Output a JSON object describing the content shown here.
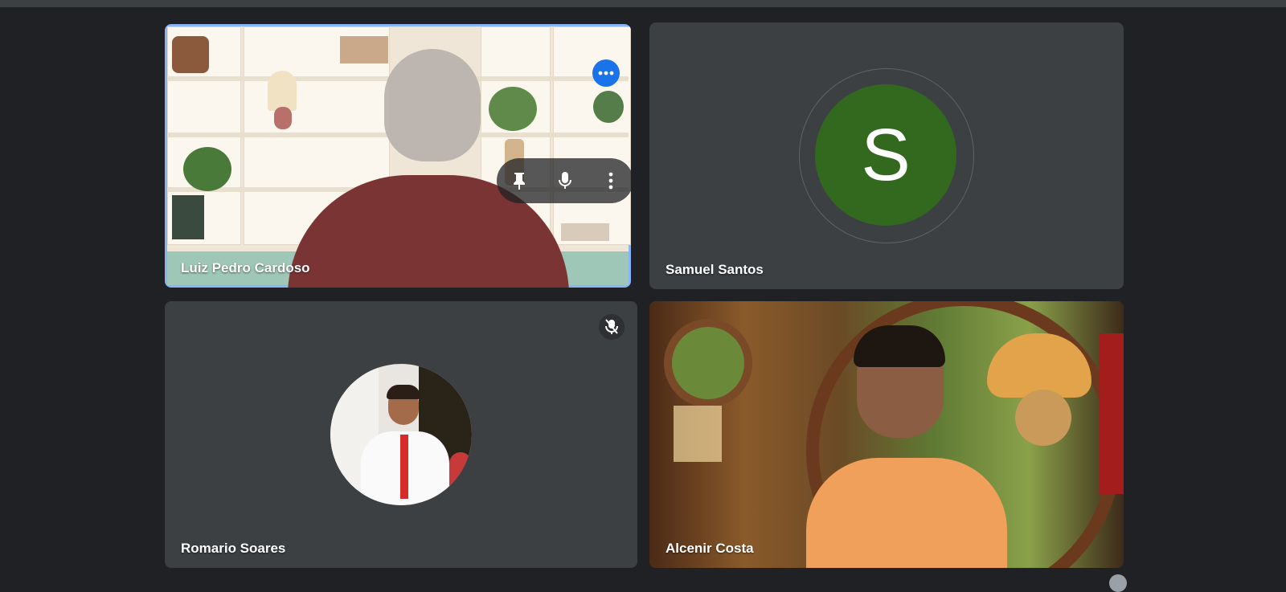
{
  "participants": [
    {
      "name": "Luiz Pedro Cardoso"
    },
    {
      "name": "Samuel Santos",
      "initial": "S",
      "avatar_color": "#33691e"
    },
    {
      "name": "Romario Soares"
    },
    {
      "name": "Alcenir Costa"
    }
  ],
  "colors": {
    "background": "#202124",
    "tile": "#3c4043",
    "active_border": "#8ab4f8",
    "accent": "#1a73e8"
  },
  "icons": {
    "pin": "pin-icon",
    "mic": "mic-icon",
    "more_vert": "more-vert-icon",
    "more_horiz": "more-horiz-icon",
    "mic_off": "mic-off-icon"
  }
}
